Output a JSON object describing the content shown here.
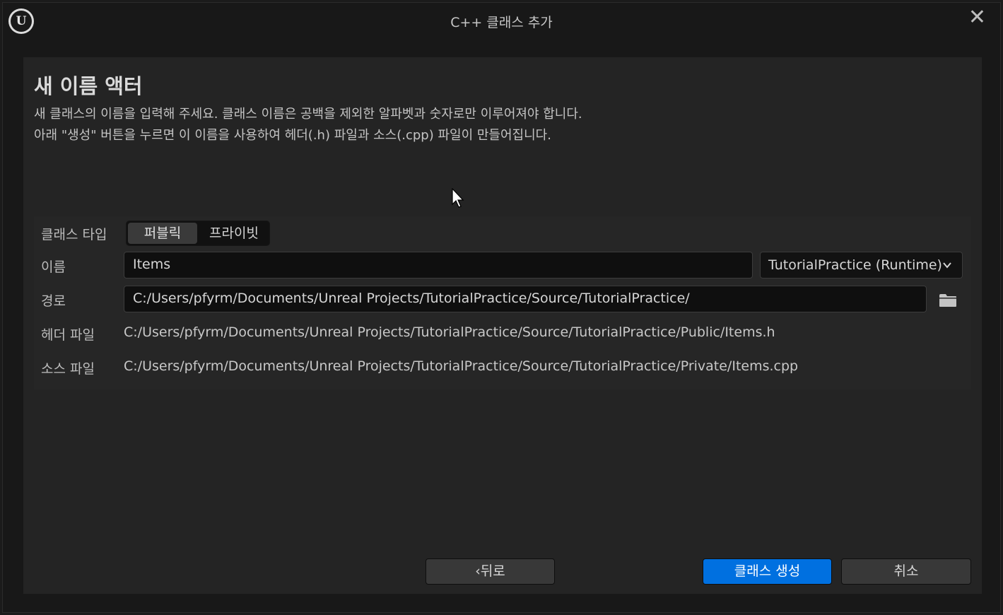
{
  "window": {
    "title": "C++ 클래스 추가",
    "logo_text": "U"
  },
  "header": {
    "heading": "새 이름 액터",
    "description_line1": "새 클래스의 이름을 입력해 주세요. 클래스 이름은 공백을 제외한 알파벳과 숫자로만 이루어져야 합니다.",
    "description_line2": "아래 \"생성\" 버튼을 누르면 이 이름을 사용하여 헤더(.h) 파일과 소스(.cpp) 파일이 만들어집니다."
  },
  "form": {
    "class_type_label": "클래스 타입",
    "class_type_options": [
      "퍼블릭",
      "프라이빗"
    ],
    "class_type_selected": "퍼블릭",
    "name_label": "이름",
    "name_value": "Items",
    "module_value": "TutorialPractice (Runtime)",
    "path_label": "경로",
    "path_value": "C:/Users/pfyrm/Documents/Unreal Projects/TutorialPractice/Source/TutorialPractice/",
    "header_file_label": "헤더 파일",
    "header_file_value": "C:/Users/pfyrm/Documents/Unreal Projects/TutorialPractice/Source/TutorialPractice/Public/Items.h",
    "source_file_label": "소스 파일",
    "source_file_value": "C:/Users/pfyrm/Documents/Unreal Projects/TutorialPractice/Source/TutorialPractice/Private/Items.cpp"
  },
  "footer": {
    "back_label": "뒤로",
    "create_label": "클래스 생성",
    "cancel_label": "취소"
  },
  "icons": {
    "close": "close-icon",
    "folder": "folder-icon",
    "chevron": "chevron-down-icon",
    "back": "chevron-left-icon"
  },
  "colors": {
    "accent": "#0070e0",
    "panel": "#242424",
    "background": "#181818"
  }
}
